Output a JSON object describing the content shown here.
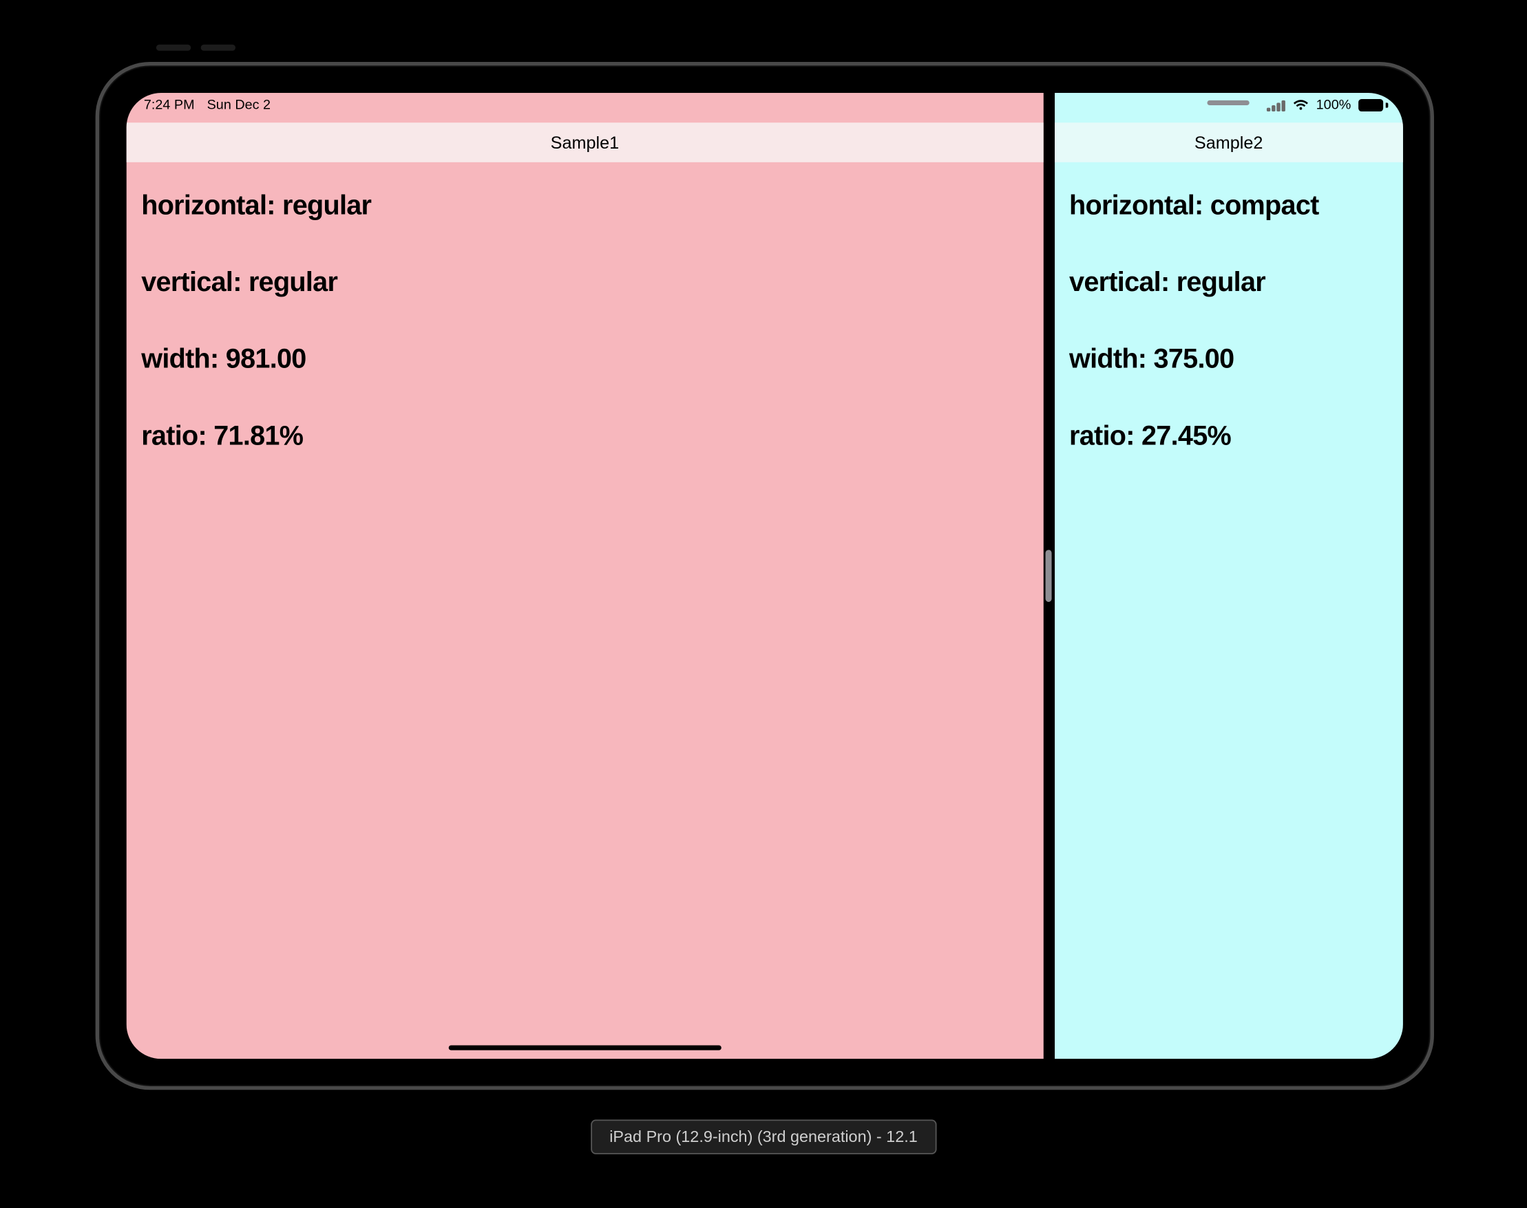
{
  "status": {
    "time": "7:24 PM",
    "date": "Sun Dec 2",
    "battery_pct": "100%"
  },
  "left": {
    "title": "Sample1",
    "metrics": {
      "horizontal": "horizontal: regular",
      "vertical": "vertical: regular",
      "width": "width: 981.00",
      "ratio": "ratio: 71.81%"
    }
  },
  "right": {
    "title": "Sample2",
    "metrics": {
      "horizontal": "horizontal: compact",
      "vertical": "vertical: regular",
      "width": "width: 375.00",
      "ratio": "ratio: 27.45%"
    }
  },
  "device_badge": "iPad Pro (12.9-inch) (3rd generation) - 12.1"
}
